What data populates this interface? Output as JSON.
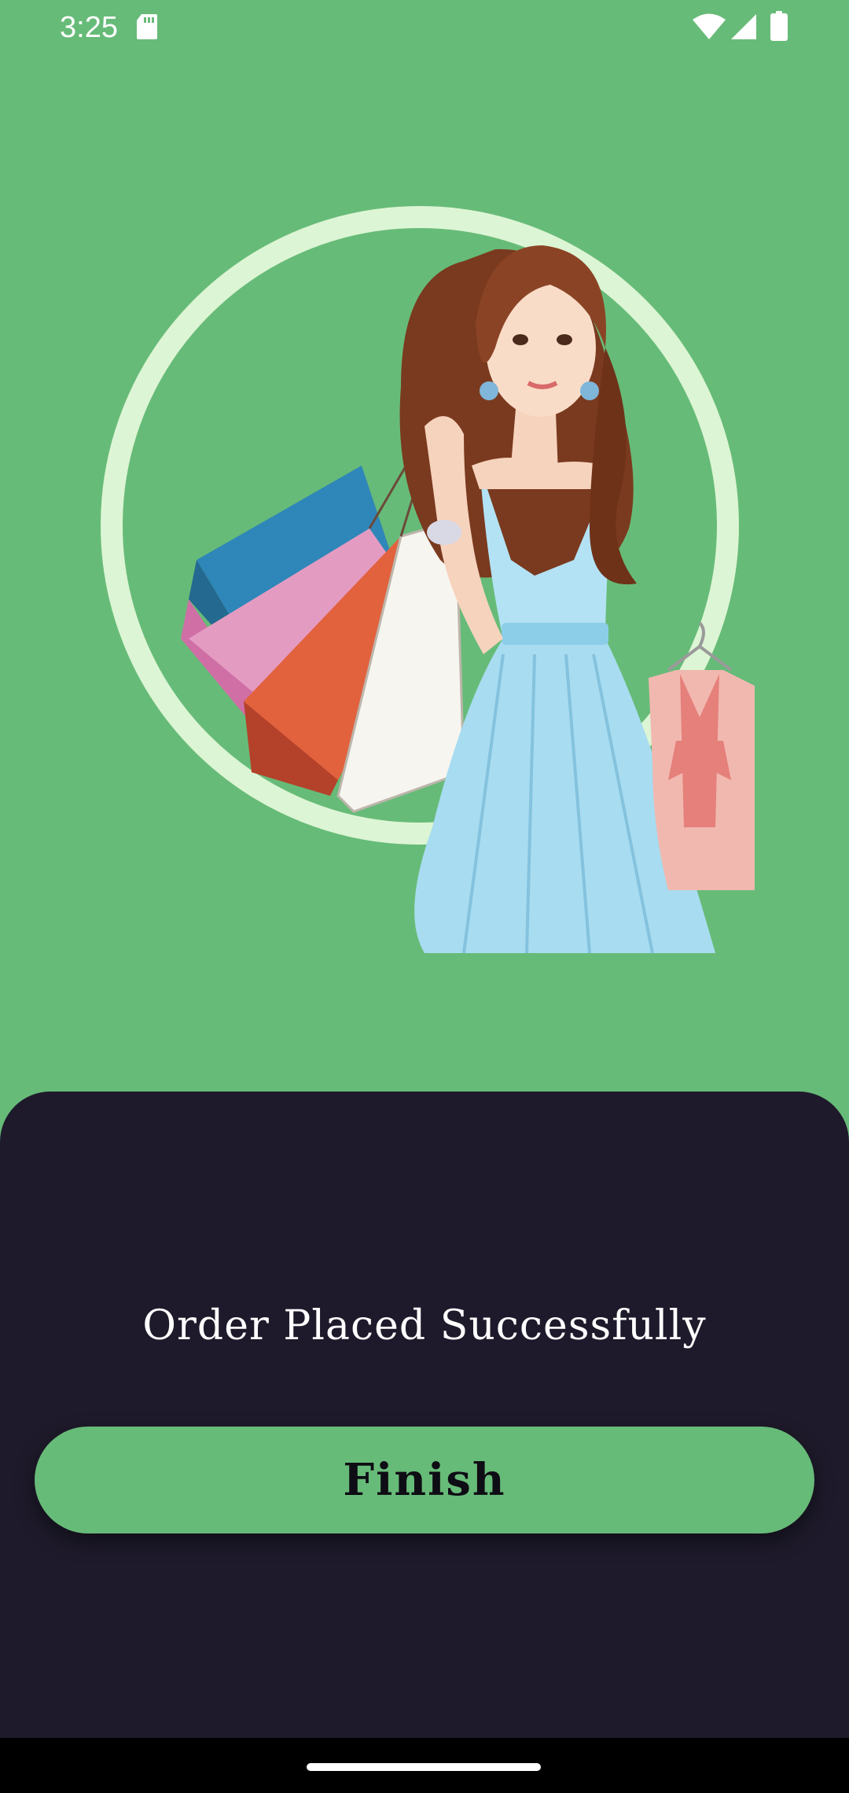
{
  "status_bar": {
    "time": "3:25",
    "icons": [
      "sd-card-icon",
      "wifi-icon",
      "signal-icon",
      "battery-icon"
    ]
  },
  "hero": {
    "illustration": "woman-with-shopping-bags-illustration"
  },
  "bottom_sheet": {
    "message": "Order Placed Successfully",
    "finish_label": "Finish"
  },
  "colors": {
    "accent_green": "#67bb78",
    "ring": "#dcf5d4",
    "sheet_background": "#1e1a2b",
    "button_text": "#0e0c14"
  }
}
